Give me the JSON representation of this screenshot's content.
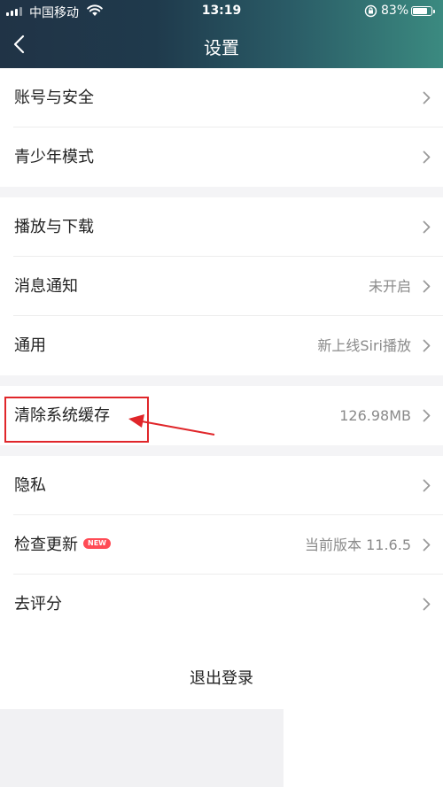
{
  "status_bar": {
    "carrier": "中国移动",
    "time": "13:19",
    "battery": "83%",
    "battery_level": 0.83
  },
  "nav": {
    "back_icon": "chevron-left-icon",
    "title": "设置"
  },
  "groups": [
    {
      "items": [
        {
          "label": "账号与安全",
          "value": ""
        },
        {
          "label": "青少年模式",
          "value": ""
        }
      ]
    },
    {
      "items": [
        {
          "label": "播放与下载",
          "value": ""
        },
        {
          "label": "消息通知",
          "value": "未开启"
        },
        {
          "label": "通用",
          "value": "新上线Siri播放"
        }
      ]
    },
    {
      "items": [
        {
          "label": "清除系统缓存",
          "value": "126.98MB"
        }
      ]
    },
    {
      "items": [
        {
          "label": "隐私",
          "value": ""
        },
        {
          "label": "检查更新",
          "badge": "NEW",
          "value": "当前版本 11.6.5"
        },
        {
          "label": "去评分",
          "value": ""
        }
      ]
    }
  ],
  "logout_label": "退出登录",
  "colors": {
    "header_start": "#203346",
    "header_end": "#3b8a80",
    "annotation": "#e0262a",
    "badge": "#ff4b55"
  }
}
